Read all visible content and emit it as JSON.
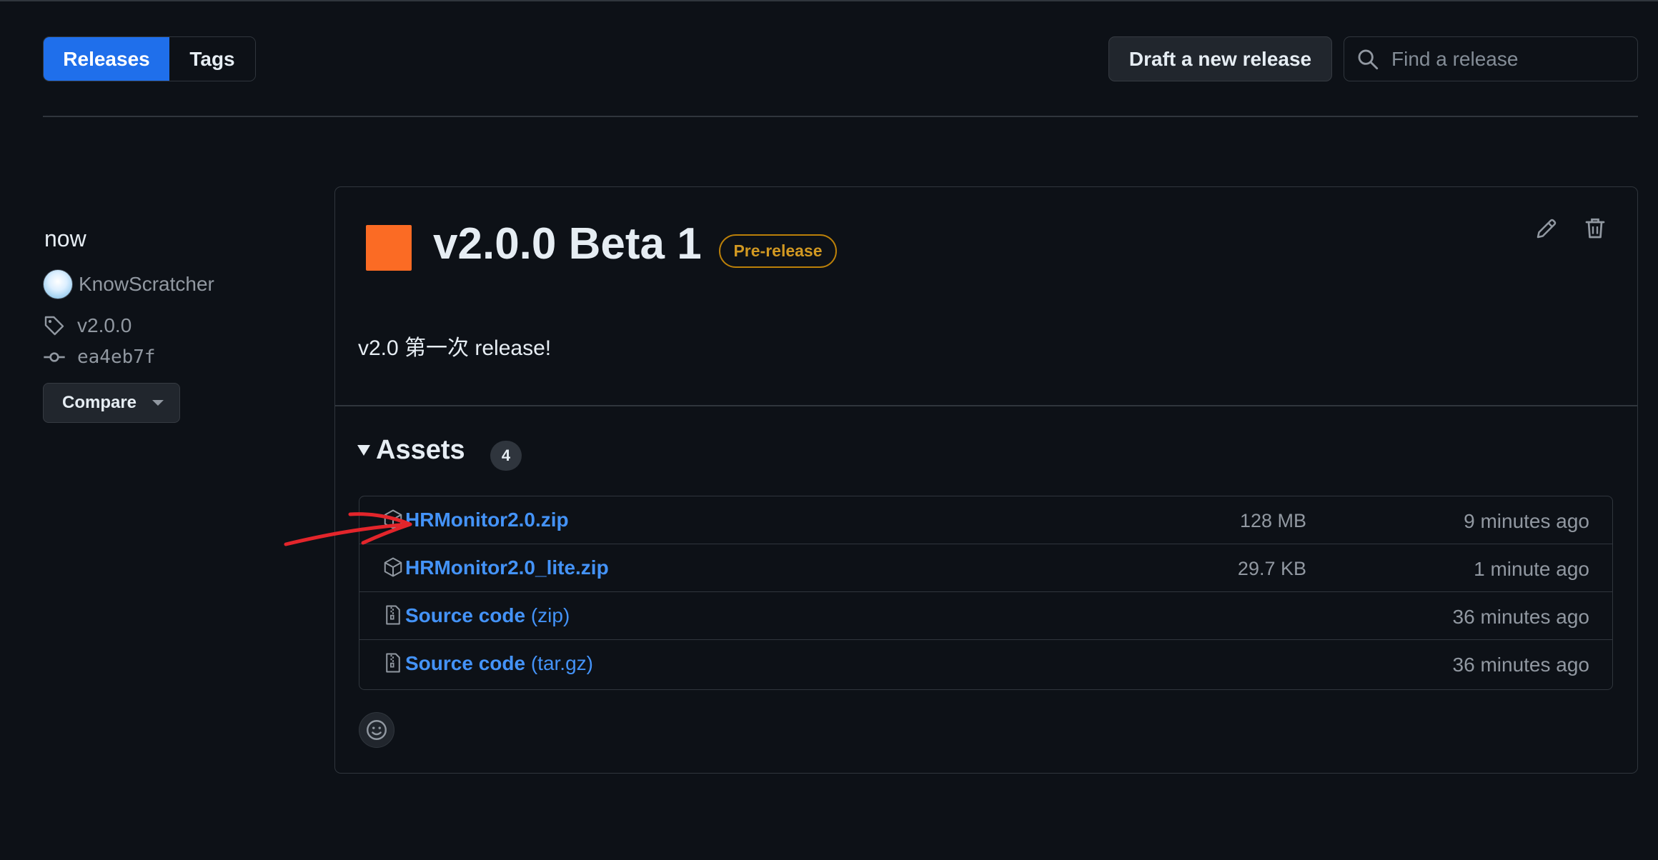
{
  "nav": {
    "tabs": [
      {
        "label": "Releases",
        "active": true
      },
      {
        "label": "Tags",
        "active": false
      }
    ],
    "draft_button": "Draft a new release",
    "search": {
      "placeholder": "Find a release",
      "value": "",
      "icon": "search-icon"
    }
  },
  "release": {
    "time": "now",
    "author": "KnowScratcher",
    "tag": "v2.0.0",
    "commit": "ea4eb7f",
    "compare_label": "Compare",
    "title": "v2.0.0 Beta 1",
    "badge": "Pre-release",
    "body": "v2.0 第一次 release!",
    "assets": {
      "label": "Assets",
      "count": "4",
      "items": [
        {
          "name": "HRMonitor2.0.zip",
          "ext": "",
          "size": "128 MB",
          "time": "9 minutes ago",
          "icon": "package-icon"
        },
        {
          "name": "HRMonitor2.0_lite.zip",
          "ext": "",
          "size": "29.7 KB",
          "time": "1 minute ago",
          "icon": "package-icon"
        },
        {
          "name": "Source code",
          "ext": "(zip)",
          "size": "",
          "time": "36 minutes ago",
          "icon": "file-zip-icon"
        },
        {
          "name": "Source code",
          "ext": "(tar.gz)",
          "size": "",
          "time": "36 minutes ago",
          "icon": "file-zip-icon"
        }
      ]
    }
  },
  "colors": {
    "background": "#0d1117",
    "accent": "#1f6feb",
    "link": "#4493f8",
    "release_square": "#fb6b24",
    "prerelease": "#d29922",
    "annotation": "#e3252b"
  }
}
